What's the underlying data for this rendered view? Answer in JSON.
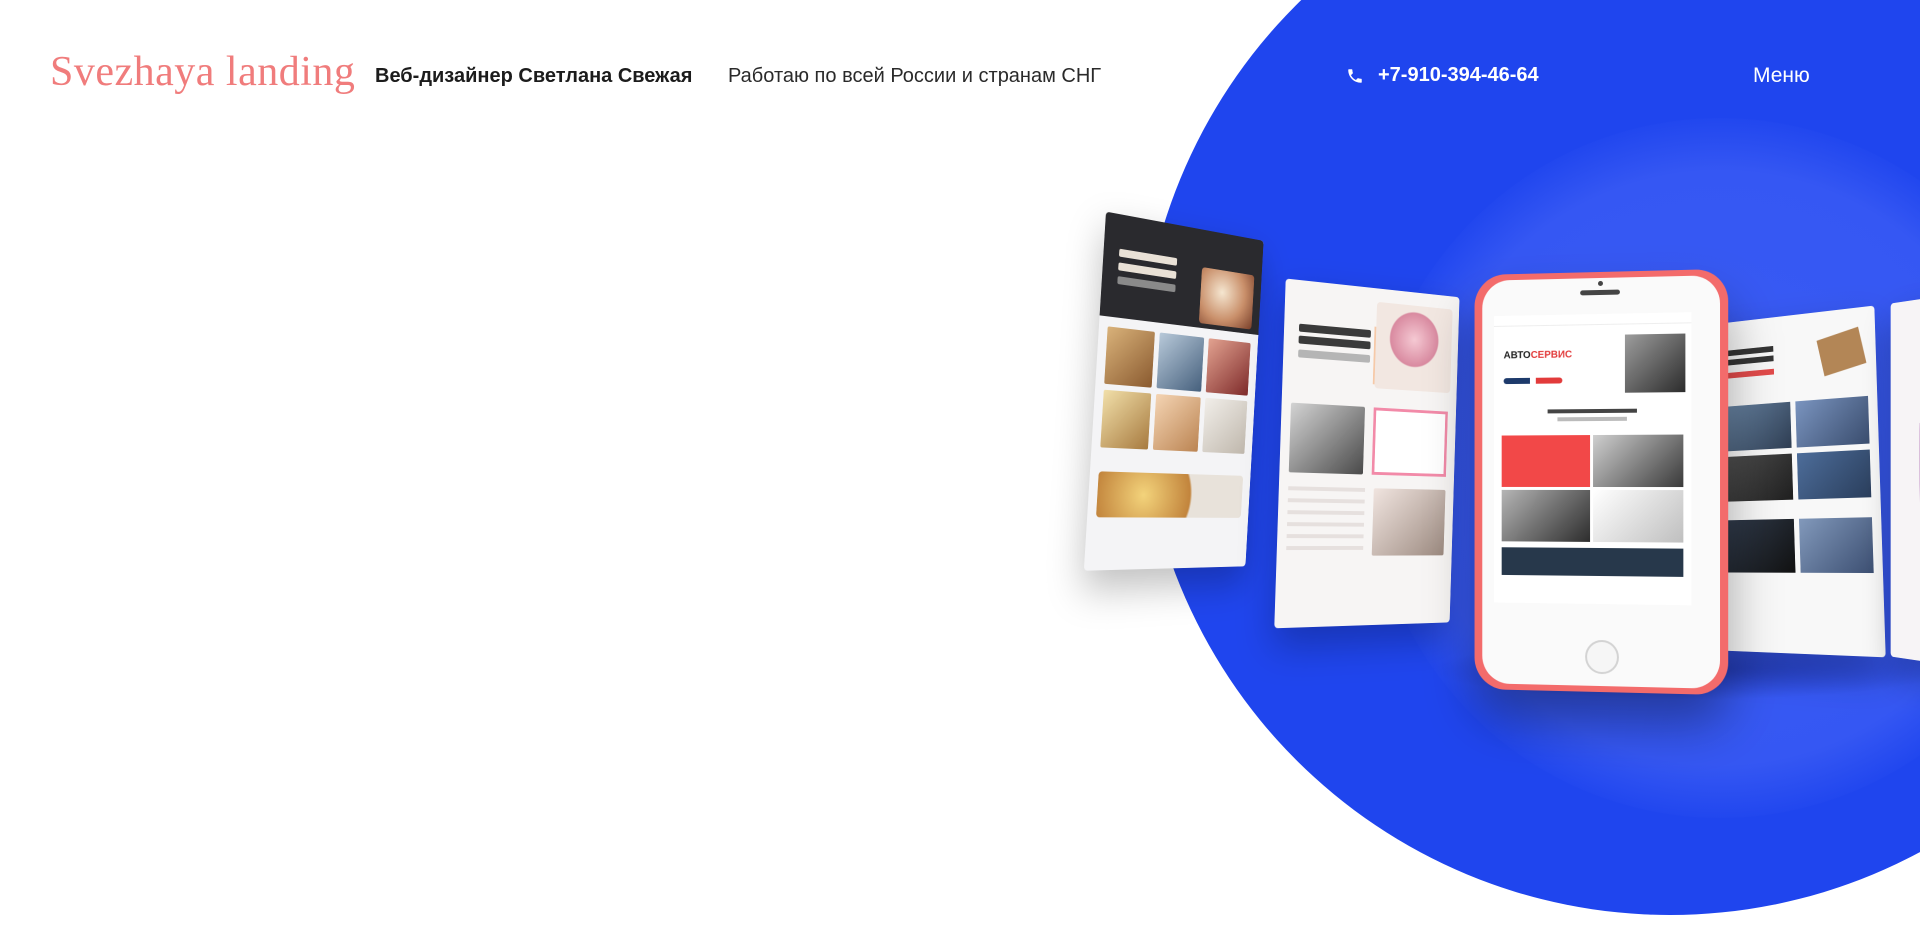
{
  "header": {
    "logo_text": "Svezhaya landing",
    "tagline": "Веб-дизайнер Светлана Свежая",
    "region": "Работаю по всей России и странам СНГ",
    "phone": {
      "icon": "phone-icon",
      "number": "+7-910-394-46-64"
    },
    "menu_label": "Меню"
  },
  "hero": {
    "circle_color": "#1f45ee",
    "mockups": [
      {
        "kind": "bakery-landing"
      },
      {
        "kind": "wedding-landing"
      },
      {
        "kind": "autoservice-phone",
        "headline_part1": "АВТО",
        "headline_part2": "СЕРВИС"
      },
      {
        "kind": "conference-landing"
      },
      {
        "kind": "partial-landing"
      }
    ]
  },
  "colors": {
    "logo": "#f07c7c",
    "accent_blue": "#1f45ee",
    "phone_body": "#f36b6b"
  }
}
